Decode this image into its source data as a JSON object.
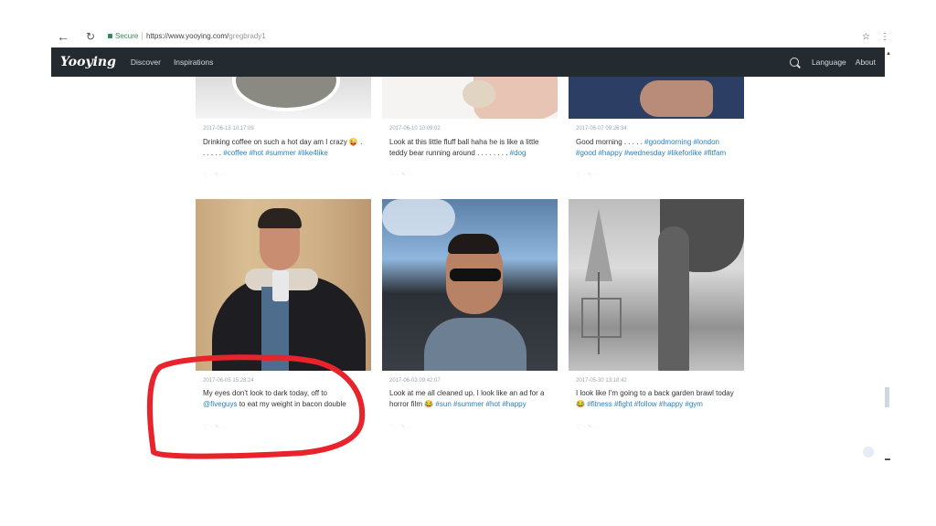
{
  "browser": {
    "secure_label": "Secure",
    "url_base": "https://www.yooying.com/",
    "url_path": "gregbrady1"
  },
  "header": {
    "logo": "Yooying",
    "nav": [
      "Discover",
      "Inspirations"
    ],
    "language": "Language",
    "about": "About"
  },
  "posts": [
    {
      "date": "2017-06-13 10:17:09",
      "text": "Drinking coffee on such a hot day am I crazy 😜 . . . . . .",
      "tags": "#coffee #hot #summer #like4like"
    },
    {
      "date": "2017-06-10 10:09:02",
      "text": "Look at this little fluff ball haha he is like a little teddy bear running around . . . . . . . .",
      "tags": "#dog"
    },
    {
      "date": "2017-06-07 09:26:34",
      "text": "Good morning . . . . .",
      "tags": "#goodmorning #london #good #happy #wednesday #likeforlike #fitfam"
    },
    {
      "date": "2017-06-05 15:28:24",
      "text": "My eyes don't look to dark today, off to",
      "tags": "@fiveguys",
      "text2": "to eat my weight in bacon double"
    },
    {
      "date": "2017-06-03 09:42:07",
      "text": "Look at me all cleaned up. I look like an ad for a horror film 😂",
      "tags": "#sun #summer #hot #happy"
    },
    {
      "date": "2017-05-30 13:18:42",
      "text": "I look like I'm going to a back garden brawl today 😂",
      "tags": "#fitness #fight #follow #happy #gym"
    }
  ],
  "colors": {
    "header_bg": "#232a30",
    "link": "#2a7fc1",
    "annotation": "#e8232b"
  }
}
